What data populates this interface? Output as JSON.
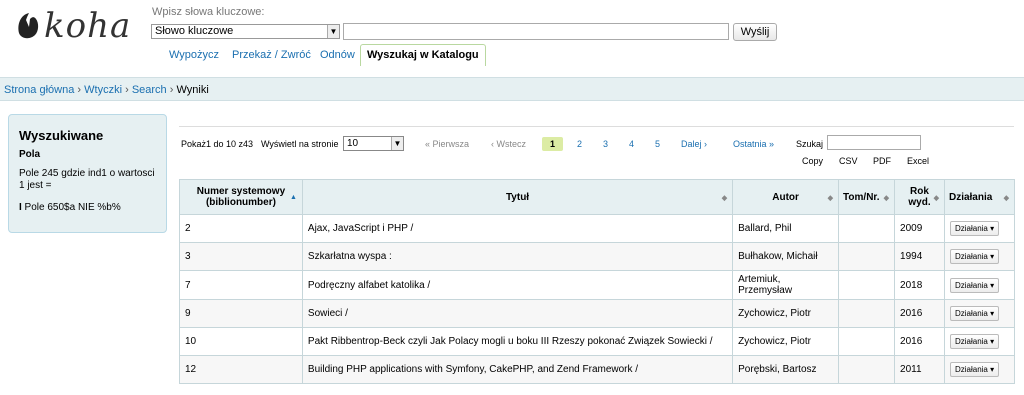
{
  "brand": {
    "logo_text": "koha"
  },
  "search": {
    "label": "Wpisz słowa kluczowe:",
    "type_selected": "Słowo kluczowe",
    "query_value": "",
    "submit_label": "Wyślij"
  },
  "tabs": [
    "Wypożycz",
    "Przekaż / Zwróć",
    "Odnów",
    "Wyszukaj w Katalogu"
  ],
  "breadcrumb": [
    "Strona główna",
    "Wtyczki",
    "Search",
    "Wyniki"
  ],
  "sidebar": {
    "title": "Wyszukiwane",
    "subtitle": "Pola",
    "criteria_1": "Pole 245 gdzie ind1 o wartosci 1 jest =",
    "criteria_2_op": "I",
    "criteria_2": " Pole 650$a NIE %b%"
  },
  "toolbar": {
    "showing": "Pokaż1 do 10 z43",
    "per_page_label": "Wyświetl na stronie",
    "per_page_value": "10",
    "first": "« Pierwsza",
    "prev": "‹ Wstecz",
    "pages": [
      "1",
      "2",
      "3",
      "4",
      "5"
    ],
    "next": "Dalej ›",
    "last": "Ostatnia »",
    "filter_label": "Szukaj",
    "filter_value": "",
    "exports": [
      "Copy",
      "CSV",
      "PDF",
      "Excel"
    ]
  },
  "table": {
    "headers": [
      "Numer systemowy (biblionumber)",
      "Tytuł",
      "Autor",
      "Tom/Nr.",
      "Rok wyd.",
      "Działania"
    ],
    "action_label": "Działania",
    "rows": [
      {
        "id": "2",
        "title": "Ajax, JavaScript i PHP /",
        "author": "Ballard, Phil",
        "vol": "",
        "year": "2009"
      },
      {
        "id": "3",
        "title": "Szkarłatna wyspa :",
        "author": "Bułhakow, Michaił",
        "vol": "",
        "year": "1994"
      },
      {
        "id": "7",
        "title": "Podręczny alfabet katolika /",
        "author": "Artemiuk, Przemysław",
        "vol": "",
        "year": "2018"
      },
      {
        "id": "9",
        "title": "Sowieci /",
        "author": "Zychowicz, Piotr",
        "vol": "",
        "year": "2016"
      },
      {
        "id": "10",
        "title": "Pakt Ribbentrop-Beck czyli Jak Polacy mogli u boku III Rzeszy pokonać Związek Sowiecki /",
        "author": "Zychowicz, Piotr",
        "vol": "",
        "year": "2016"
      },
      {
        "id": "12",
        "title": "Building PHP applications with Symfony, CakePHP, and Zend Framework /",
        "author": "Porębski, Bartosz",
        "vol": "",
        "year": "2011"
      }
    ]
  }
}
